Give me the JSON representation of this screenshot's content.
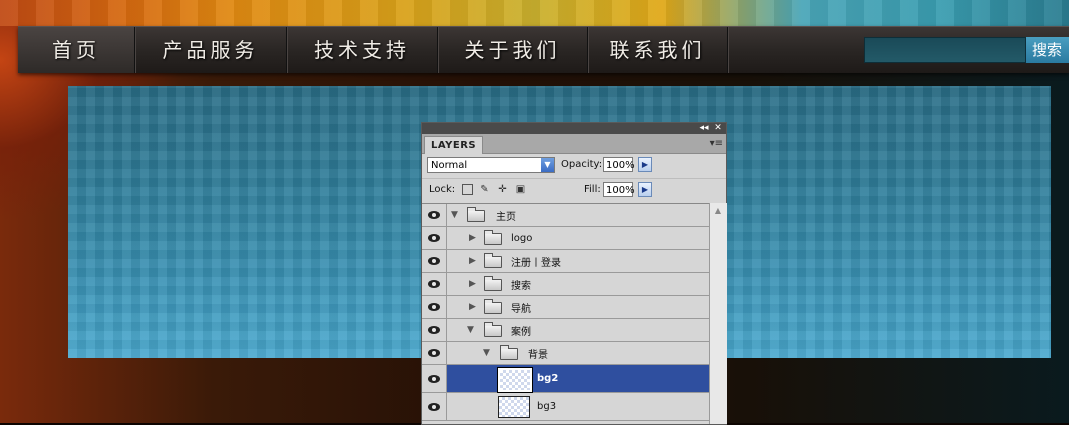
{
  "nav": {
    "items": [
      {
        "label": "首页"
      },
      {
        "label": "产品服务"
      },
      {
        "label": "技术支持"
      },
      {
        "label": "关于我们"
      },
      {
        "label": "联系我们"
      }
    ],
    "active_index": 0,
    "search_button": "搜索"
  },
  "layers_panel": {
    "title_buttons": {
      "collapse": "◂◂",
      "close": "✕"
    },
    "tab": "LAYERS",
    "menu_icon": "panel-menu-icon",
    "blend_mode": "Normal",
    "opacity_label": "Opacity:",
    "opacity_value": "100%",
    "lock_label": "Lock:",
    "fill_label": "Fill:",
    "fill_value": "100%",
    "layers": [
      {
        "name": "主页",
        "type": "group",
        "expanded": true,
        "selected": false
      },
      {
        "name": "logo",
        "type": "group",
        "expanded": false,
        "selected": false
      },
      {
        "name": "注册丨登录",
        "type": "group",
        "expanded": false,
        "selected": false
      },
      {
        "name": "搜索",
        "type": "group",
        "expanded": false,
        "selected": false
      },
      {
        "name": "导航",
        "type": "group",
        "expanded": false,
        "selected": false
      },
      {
        "name": "案例",
        "type": "group",
        "expanded": true,
        "selected": false
      },
      {
        "name": "背景",
        "type": "group",
        "expanded": true,
        "selected": false
      },
      {
        "name": "bg2",
        "type": "layer",
        "selected": true
      },
      {
        "name": "bg3",
        "type": "layer",
        "selected": false
      }
    ]
  },
  "colors": {
    "selection": "#2f4f9f",
    "canvas_blue": "#3a92b4",
    "nav_bg": "#2a2624"
  }
}
